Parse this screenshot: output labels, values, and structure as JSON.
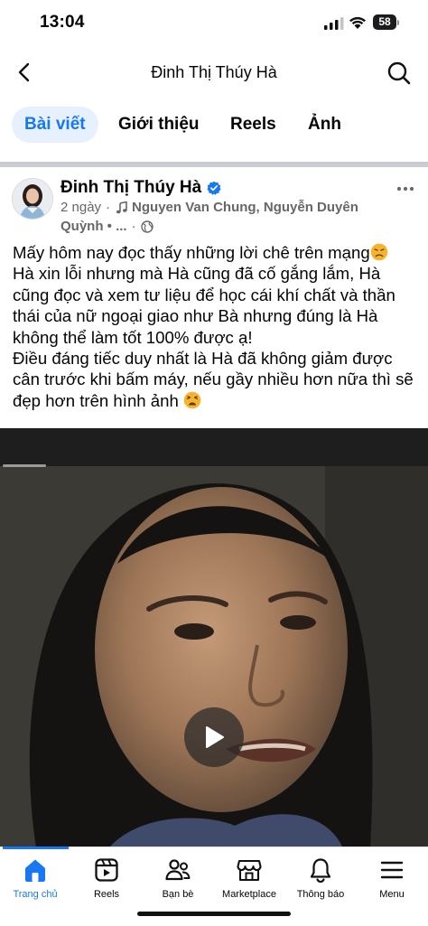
{
  "status_bar": {
    "time": "13:04",
    "battery": "58"
  },
  "header": {
    "title": "Đinh Thị Thúy Hà",
    "back_icon": "chevron-left-icon",
    "search_icon": "search-icon"
  },
  "tabs": [
    {
      "label": "Bài viết",
      "active": true
    },
    {
      "label": "Giới thiệu",
      "active": false
    },
    {
      "label": "Reels",
      "active": false
    },
    {
      "label": "Ảnh",
      "active": false
    }
  ],
  "post": {
    "author": "Đinh Thị Thúy Hà",
    "time": "2 ngày",
    "meta_sep": "·",
    "song_line1": "Nguyen Van Chung, Nguyễn Duyên",
    "song_line2": "Quỳnh • ...",
    "text_lines": [
      "Mấy hôm nay đọc thấy những lời chê trên mạng",
      "Hà xin lỗi nhưng mà Hà cũng đã cố gắng lắm, Hà cũng đọc và xem tư liệu để học cái khí chất và thần thái của nữ ngoại giao như Bà nhưng đúng là Hà không thể làm tốt 100% được ạ!",
      "Điều đáng tiếc duy nhất là Hà đã không giảm được cân trước khi bấm máy, nếu gầy nhiều hơn nữa thì sẽ đẹp hơn trên hình ảnh"
    ]
  },
  "bottom_nav": [
    {
      "label": "Trang chủ",
      "icon": "home-icon",
      "active": true
    },
    {
      "label": "Reels",
      "icon": "reels-icon",
      "active": false
    },
    {
      "label": "Bạn bè",
      "icon": "friends-icon",
      "active": false
    },
    {
      "label": "Marketplace",
      "icon": "marketplace-icon",
      "active": false
    },
    {
      "label": "Thông báo",
      "icon": "bell-icon",
      "active": false
    },
    {
      "label": "Menu",
      "icon": "menu-icon",
      "active": false
    }
  ],
  "colors": {
    "accent": "#1877f2",
    "tab_active_bg": "#e7f0fd",
    "secondary_text": "#65676b"
  }
}
